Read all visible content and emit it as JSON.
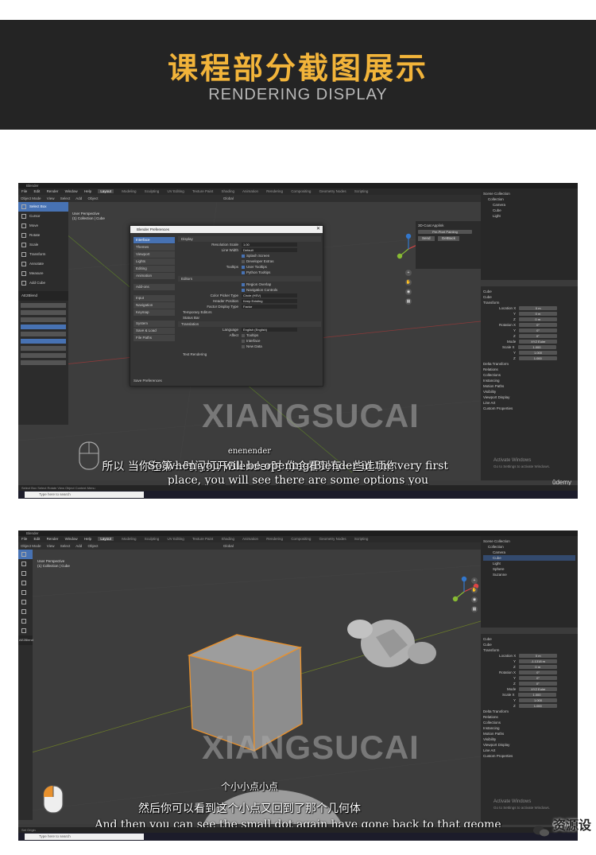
{
  "banner": {
    "title": "课程部分截图展示",
    "subtitle": "RENDERING  DISPLAY"
  },
  "shot1": {
    "window_title": "Blender",
    "menu": [
      "File",
      "Edit",
      "Render",
      "Window",
      "Help"
    ],
    "workspaces": [
      "Layout",
      "Modeling",
      "Sculpting",
      "UV Editing",
      "Texture Paint",
      "Shading",
      "Animation",
      "Rendering",
      "Compositing",
      "Geometry Nodes",
      "Scripting"
    ],
    "header": [
      "Object Mode",
      "View",
      "Select",
      "Add",
      "Object",
      "Global"
    ],
    "viewport_info": [
      "User Perspective",
      "(1) Collection | Cube"
    ],
    "tools": [
      "Select Box",
      "Cursor",
      "Move",
      "Rotate",
      "Scale",
      "Transform",
      "Annotate",
      "Measure",
      "Add Cube"
    ],
    "panel_title": "AE2Blend",
    "dialog": {
      "title": "Blender Preferences",
      "nav": [
        "Interface",
        "Themes",
        "Viewport",
        "Lights",
        "Editing",
        "Animation",
        "Add-ons",
        "Input",
        "Navigation",
        "Keymap",
        "System",
        "Save & Load",
        "File Paths"
      ],
      "sections": {
        "display": "Display",
        "editors": "Editors",
        "translation": "Translation",
        "temp_editors": "Temporary Editors",
        "status_bar": "Status Bar",
        "text_rendering": "Text Rendering"
      },
      "rows": {
        "resolution_label": "Resolution Scale",
        "resolution_value": "1.00",
        "line_width_label": "Line Width",
        "line_width_value": "Default",
        "splash": "Splash Screen",
        "dev_extras": "Developer Extras",
        "tooltips_label": "Tooltips",
        "user_tooltips": "User Tooltips",
        "python_tooltips": "Python Tooltips",
        "region_overlap": "Region Overlap",
        "nav_controls": "Navigation Controls",
        "color_picker_label": "Color Picker Type",
        "color_picker_value": "Circle (HSV)",
        "header_pos_label": "Header Position",
        "header_pos_value": "Keep Existing",
        "factor_label": "Factor Display Type",
        "factor_value": "Factor",
        "language_label": "Language",
        "language_value": "English (English)",
        "affect_label": "Affect",
        "tooltips": "Tooltips",
        "interface": "Interface",
        "new_data": "New Data"
      },
      "save_label": "Save Preferences"
    },
    "n_panel": {
      "title": "3D-Coat Applink",
      "mode": "Per-Pixel Painting",
      "send": "Send",
      "getback": "GetBack"
    },
    "outliner": [
      "Scene Collection",
      "Collection",
      "Camera",
      "Cube",
      "Light"
    ],
    "props": [
      "Cube",
      "Cube",
      "Transform",
      "Location X",
      "Y",
      "Z",
      "Rotation X",
      "Y",
      "Z",
      "Mode",
      "Scale X",
      "Y",
      "Z",
      "Delta Transform",
      "Relations",
      "Collections",
      "Instancing",
      "Motion Paths",
      "Visibility",
      "Viewport Display",
      "Line Art",
      "Custom Properties"
    ],
    "prop_values": [
      "0 m",
      "0 m",
      "0 m",
      "0°",
      "0°",
      "0°",
      "XYZ Euler",
      "1.000",
      "1.000",
      "1.000"
    ],
    "watermark": "XIANGSUCAI",
    "sub_fragment": "enenender",
    "sub_cn": "所以 当你在第一时间打开Blender时 你会看到有一些选项你",
    "sub_en_1": "So when you will be opening Blender in the very first",
    "sub_en_2": "place, you will see there are some options you",
    "activate": [
      "Activate Windows",
      "Go to Settings to activate Windows."
    ],
    "udemy": "ûdemy",
    "search": "Type here to search",
    "status": "Select   Box Select   Rotate View   Object Context Menu"
  },
  "shot2": {
    "window_title": "Blender",
    "menu": [
      "File",
      "Edit",
      "Render",
      "Window",
      "Help"
    ],
    "workspaces": [
      "Layout",
      "Modeling",
      "Sculpting",
      "UV Editing",
      "Texture Paint",
      "Shading",
      "Animation",
      "Rendering",
      "Compositing",
      "Geometry Nodes",
      "Scripting"
    ],
    "header": [
      "Object Mode",
      "View",
      "Select",
      "Add",
      "Object",
      "Global"
    ],
    "viewport_info": [
      "User Perspective",
      "(1) Collection | Cube"
    ],
    "panel_title": "AE2Blend",
    "outliner": [
      "Scene Collection",
      "Collection",
      "Camera",
      "Cube",
      "Light",
      "Sphere",
      "Suzanne"
    ],
    "props": [
      "Cube",
      "Cube",
      "Transform",
      "Location X",
      "Y",
      "Z",
      "Rotation X",
      "Y",
      "Z",
      "Mode",
      "Scale X",
      "Y",
      "Z",
      "Delta Transform",
      "Relations",
      "Collections",
      "Instancing",
      "Motion Paths",
      "Visibility",
      "Viewport Display",
      "Line Art",
      "Custom Properties"
    ],
    "prop_values": [
      "0 m",
      "-1.1318 m",
      "0 m",
      "0°",
      "0°",
      "0°",
      "XYZ Euler",
      "1.000",
      "1.000",
      "1.000"
    ],
    "watermark": "XIANGSUCAI",
    "sub_fragment": "个小小点小点",
    "sub_cn": "然后你可以看到这个小点又回到了那个几何体",
    "sub_en": "And then you can see the small dot again have gone back to that geome",
    "activate": [
      "Activate Windows",
      "Go to Settings to activate Windows."
    ],
    "udemy": "ûdemy",
    "search": "Type here to search",
    "status": "Set Origin",
    "brand": "资源设"
  },
  "colors": {
    "banner_bg": "#242424",
    "banner_title": "#f2b43a",
    "blender_accent": "#4772b3",
    "selection_outline": "#e8912d"
  }
}
